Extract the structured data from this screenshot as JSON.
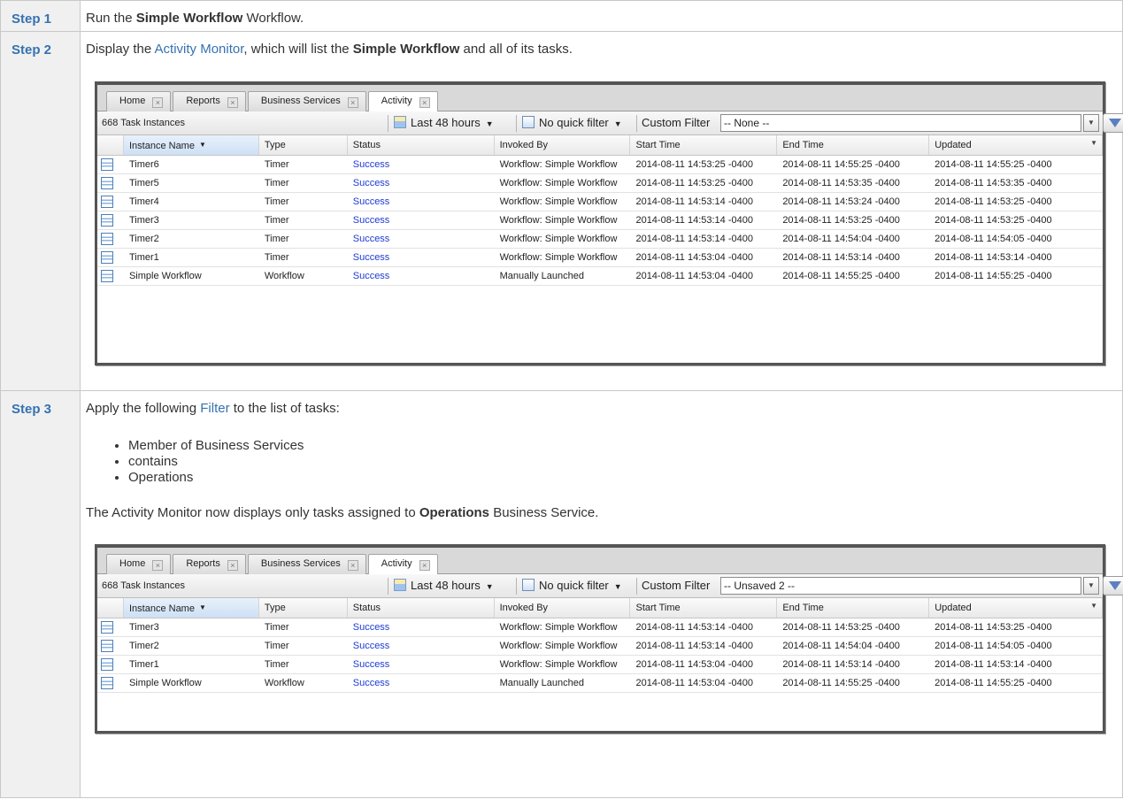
{
  "steps": [
    {
      "label": "Step 1",
      "text_before": "Run the ",
      "bold": "Simple Workflow",
      "text_after": " Workflow."
    },
    {
      "label": "Step 2",
      "text_before": "Display the ",
      "link": "Activity Monitor",
      "text_mid": ", which will list the ",
      "bold": "Simple Workflow",
      "text_after": " and all of its tasks."
    },
    {
      "label": "Step 3",
      "text_before": "Apply the following ",
      "link": "Filter",
      "text_after": " to the list of tasks:",
      "bullets": [
        "Member of Business Services",
        "contains",
        "Operations"
      ],
      "result_before": "The Activity Monitor now displays only tasks assigned to ",
      "result_bold": "Operations",
      "result_after": " Business Service."
    }
  ],
  "screenshots": [
    {
      "tabs": [
        "Home",
        "Reports",
        "Business Services",
        "Activity"
      ],
      "active_tab": "Activity",
      "count_label": "668 Task Instances",
      "range_label": "Last 48 hours",
      "quick_filter_label": "No quick filter",
      "custom_filter_label": "Custom Filter",
      "custom_filter_value": "-- None --",
      "filter_button": "Filter...",
      "columns": [
        "Instance Name",
        "Type",
        "Status",
        "Invoked By",
        "Start Time",
        "End Time",
        "Updated"
      ],
      "rows": [
        [
          "Timer6",
          "Timer",
          "Success",
          "Workflow: Simple Workflow",
          "2014-08-11 14:53:25 -0400",
          "2014-08-11 14:55:25 -0400",
          "2014-08-11 14:55:25 -0400"
        ],
        [
          "Timer5",
          "Timer",
          "Success",
          "Workflow: Simple Workflow",
          "2014-08-11 14:53:25 -0400",
          "2014-08-11 14:53:35 -0400",
          "2014-08-11 14:53:35 -0400"
        ],
        [
          "Timer4",
          "Timer",
          "Success",
          "Workflow: Simple Workflow",
          "2014-08-11 14:53:14 -0400",
          "2014-08-11 14:53:24 -0400",
          "2014-08-11 14:53:25 -0400"
        ],
        [
          "Timer3",
          "Timer",
          "Success",
          "Workflow: Simple Workflow",
          "2014-08-11 14:53:14 -0400",
          "2014-08-11 14:53:25 -0400",
          "2014-08-11 14:53:25 -0400"
        ],
        [
          "Timer2",
          "Timer",
          "Success",
          "Workflow: Simple Workflow",
          "2014-08-11 14:53:14 -0400",
          "2014-08-11 14:54:04 -0400",
          "2014-08-11 14:54:05 -0400"
        ],
        [
          "Timer1",
          "Timer",
          "Success",
          "Workflow: Simple Workflow",
          "2014-08-11 14:53:04 -0400",
          "2014-08-11 14:53:14 -0400",
          "2014-08-11 14:53:14 -0400"
        ],
        [
          "Simple Workflow",
          "Workflow",
          "Success",
          "Manually Launched",
          "2014-08-11 14:53:04 -0400",
          "2014-08-11 14:55:25 -0400",
          "2014-08-11 14:55:25 -0400"
        ]
      ]
    },
    {
      "tabs": [
        "Home",
        "Reports",
        "Business Services",
        "Activity"
      ],
      "active_tab": "Activity",
      "count_label": "668 Task Instances",
      "range_label": "Last 48 hours",
      "quick_filter_label": "No quick filter",
      "custom_filter_label": "Custom Filter",
      "custom_filter_value": "-- Unsaved 2 --",
      "filter_button": "Filter...",
      "columns": [
        "Instance Name",
        "Type",
        "Status",
        "Invoked By",
        "Start Time",
        "End Time",
        "Updated"
      ],
      "rows": [
        [
          "Timer3",
          "Timer",
          "Success",
          "Workflow: Simple Workflow",
          "2014-08-11 14:53:14 -0400",
          "2014-08-11 14:53:25 -0400",
          "2014-08-11 14:53:25 -0400"
        ],
        [
          "Timer2",
          "Timer",
          "Success",
          "Workflow: Simple Workflow",
          "2014-08-11 14:53:14 -0400",
          "2014-08-11 14:54:04 -0400",
          "2014-08-11 14:54:05 -0400"
        ],
        [
          "Timer1",
          "Timer",
          "Success",
          "Workflow: Simple Workflow",
          "2014-08-11 14:53:04 -0400",
          "2014-08-11 14:53:14 -0400",
          "2014-08-11 14:53:14 -0400"
        ],
        [
          "Simple Workflow",
          "Workflow",
          "Success",
          "Manually Launched",
          "2014-08-11 14:53:04 -0400",
          "2014-08-11 14:55:25 -0400",
          "2014-08-11 14:55:25 -0400"
        ]
      ]
    }
  ],
  "colors": {
    "step_label": "#3572b0",
    "link": "#3572b0",
    "status_success": "#1d3bd3"
  }
}
